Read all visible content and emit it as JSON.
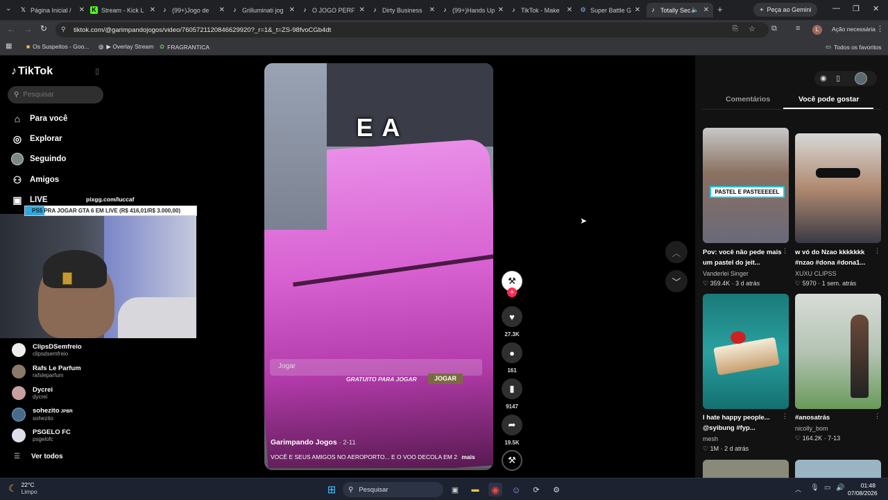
{
  "browser": {
    "tabs": [
      {
        "title": "Página Inicial /",
        "icon": "x-logo-icon"
      },
      {
        "title": "Stream - Kick L",
        "icon": "kick-icon"
      },
      {
        "title": "(99+)Jogo de",
        "icon": "tiktok-icon"
      },
      {
        "title": "Grilluminati jog",
        "icon": "tiktok-icon"
      },
      {
        "title": "O JOGO PERFE",
        "icon": "tiktok-icon"
      },
      {
        "title": "Dirty Business",
        "icon": "tiktok-icon"
      },
      {
        "title": "(99+)Hands Up",
        "icon": "tiktok-icon"
      },
      {
        "title": "TikTok - Make",
        "icon": "tiktok-icon"
      },
      {
        "title": "Super Battle G",
        "icon": "steam-icon"
      },
      {
        "title": "Totally Sec",
        "icon": "tiktok-icon"
      }
    ],
    "gemini_label": "Peça ao Gemini",
    "url": "tiktok.com/@garimpandojogos/video/7605721120846629920?_r=1&_t=ZS-98fvoCGb4dt",
    "action_label": "Ação necessária",
    "profile_initial": "L",
    "bookmarks": [
      "Os Suspeitos - Goo...",
      "▶ Overlay Stream",
      "FRAGRANTICA"
    ],
    "all_favorites": "Todos os favoritos"
  },
  "tiktok": {
    "logo": "TikTok",
    "search_placeholder": "Pesquisar",
    "nav": [
      {
        "label": "Para você",
        "icon": "home-icon"
      },
      {
        "label": "Explorar",
        "icon": "compass-icon"
      },
      {
        "label": "Seguindo",
        "icon": "following-avatar-icon"
      },
      {
        "label": "Amigos",
        "icon": "friends-icon"
      },
      {
        "label": "LIVE",
        "icon": "live-icon"
      }
    ],
    "following": [
      {
        "name": "ClipsDSemfreio",
        "user": "clipsdsemfreio"
      },
      {
        "name": "Rafs Le Parfum",
        "user": "rafsleparfum"
      },
      {
        "name": "Dycrei",
        "user": "dycrei"
      },
      {
        "name": "sohezito",
        "suffix": "JPBR",
        "user": "sohezito"
      },
      {
        "name": "PSGELO FC",
        "user": "psgelofc"
      }
    ],
    "see_all": "Ver todos"
  },
  "stream_overlay": {
    "pix_url": "pixgg.com/luccaf",
    "banner": "PS5 PRA JOGAR GTA 6 EM LIVE (R$ 416,01/R$ 3.000,00)"
  },
  "video": {
    "caption_big": "E A",
    "ad_search_placeholder": "Jogar",
    "ad_free": "GRATUITO PARA JOGAR",
    "ad_play": "JOGAR",
    "author": "Garimpando Jogos",
    "date": "2-11",
    "description": "VOCÊ E SEUS AMIGOS NO AEROPORTO... E O VOO DECOLA EM 2",
    "more": "mais",
    "likes": "27.3K",
    "comments": "161",
    "saves": "9147",
    "shares": "19.5K"
  },
  "right_panel": {
    "tab_comments": "Comentários",
    "tab_suggested": "Você pode gostar",
    "cards": [
      {
        "title": "Pov: você não pede mais um pastel do jeit...",
        "author": "Vanderlei Singer",
        "likes": "359.4K",
        "when": "3 d atrás",
        "overlay": "PASTEL E PASTEEEEEL"
      },
      {
        "title": "w vó do Nzao kkkkkkk #nzao #dona #dona1...",
        "author": "XUXU CLIPSS",
        "likes": "5970",
        "when": "1 sem. atrás",
        "overlay": ""
      },
      {
        "title": "I hate happy people... @syibung #fyp...",
        "author": "mesh",
        "likes": "1M",
        "when": "2 d atrás",
        "overlay": ""
      },
      {
        "title": "#anosatrás",
        "author": "nicolly_bom",
        "likes": "164.2K",
        "when": "7-13",
        "overlay": ""
      }
    ]
  },
  "taskbar": {
    "weather_temp": "22°C",
    "weather_desc": "Limpo",
    "search_label": "Pesquisar",
    "time": "01:48",
    "date": "07/08/2026"
  },
  "colors": {
    "tiktok_pink": "#fe2c55",
    "panel_bg": "#121212",
    "tab_bar": "#202124"
  }
}
